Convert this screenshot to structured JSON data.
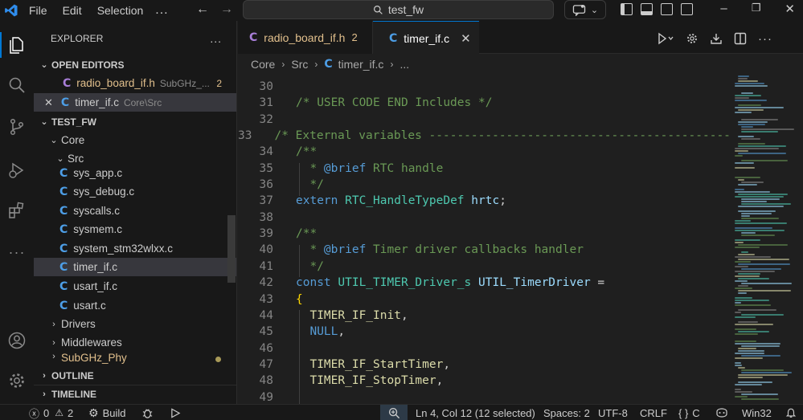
{
  "titlebar": {
    "menu": [
      "File",
      "Edit",
      "Selection"
    ],
    "more": "...",
    "search": "test_fw"
  },
  "sidebar": {
    "title": "EXPLORER",
    "more": "...",
    "open_editors_label": "OPEN EDITORS",
    "open_editors": [
      {
        "name": "radio_board_if.h",
        "desc": "SubGHz_...",
        "badge": "2"
      },
      {
        "name": "timer_if.c",
        "desc": "Core\\Src",
        "close": "✕"
      }
    ],
    "project_label": "TEST_FW",
    "tree": {
      "core": "Core",
      "src": "Src",
      "files": [
        "sys_app.c",
        "sys_debug.c",
        "syscalls.c",
        "sysmem.c",
        "system_stm32wlxx.c",
        "timer_if.c",
        "usart_if.c",
        "usart.c"
      ],
      "drivers": "Drivers",
      "middlewares": "Middlewares",
      "subghz": "SubGHz_Phy"
    },
    "outline_label": "OUTLINE",
    "timeline_label": "TIMELINE"
  },
  "tabs": [
    {
      "name": "radio_board_if.h",
      "badge": "2"
    },
    {
      "name": "timer_if.c",
      "close": "✕"
    }
  ],
  "breadcrumb": {
    "parts": [
      "Core",
      "Src",
      "timer_if.c",
      "..."
    ]
  },
  "code": {
    "lines": [
      {
        "n": "30",
        "text": ""
      },
      {
        "n": "31",
        "text": "/* USER CODE END Includes */"
      },
      {
        "n": "32",
        "text": ""
      },
      {
        "n": "33",
        "text": "/* External variables ---------------------------------------------"
      },
      {
        "n": "34",
        "text": "/**"
      },
      {
        "n": "35",
        "text": "  * @brief RTC handle"
      },
      {
        "n": "36",
        "text": "  */"
      },
      {
        "n": "37",
        "text": "extern RTC_HandleTypeDef hrtc;"
      },
      {
        "n": "38",
        "text": ""
      },
      {
        "n": "39",
        "text": "/**"
      },
      {
        "n": "40",
        "text": "  * @brief Timer driver callbacks handler"
      },
      {
        "n": "41",
        "text": "  */"
      },
      {
        "n": "42",
        "text": "const UTIL_TIMER_Driver_s UTIL_TimerDriver ="
      },
      {
        "n": "43",
        "text": "{"
      },
      {
        "n": "44",
        "text": "  TIMER_IF_Init,"
      },
      {
        "n": "45",
        "text": "  NULL,"
      },
      {
        "n": "46",
        "text": ""
      },
      {
        "n": "47",
        "text": "  TIMER_IF_StartTimer,"
      },
      {
        "n": "48",
        "text": "  TIMER_IF_StopTimer,"
      },
      {
        "n": "49",
        "text": ""
      }
    ],
    "tokens": {
      "c31": "/* USER CODE END Includes */",
      "c33": "/* External variables ---------------------------------------------",
      "c34": "/**",
      "c35a": "  * ",
      "c35b": "@brief",
      "c35c": " RTC handle",
      "c36": "  */",
      "k37": "extern",
      "t37": "RTC_HandleTypeDef",
      "v37": "hrtc",
      "p37": ";",
      "c39": "/**",
      "c40a": "  * ",
      "c40b": "@brief",
      "c40c": " Timer driver callbacks handler",
      "c41": "  */",
      "k42": "const",
      "t42": "UTIL_TIMER_Driver_s",
      "v42": "UTIL_TimerDriver",
      "p42": " =",
      "b43": "{",
      "f44": "TIMER_IF_Init",
      "f45": "NULL",
      "f47": "TIMER_IF_StartTimer",
      "f48": "TIMER_IF_StopTimer",
      "comma": ","
    }
  },
  "status": {
    "errors": "0",
    "warnings": "2",
    "build": "Build",
    "position": "Ln 4, Col 12 (12 selected)",
    "spaces": "Spaces: 2",
    "encoding": "UTF-8",
    "eol": "CRLF",
    "language": "C",
    "platform": "Win32"
  },
  "colors": {
    "accent": "#0078d4",
    "c_icon": "#4d9ee6",
    "modified": "#e2c08d",
    "comment": "#6a9955",
    "keyword": "#569cd6",
    "type": "#4ec9b0",
    "function": "#dcdcaa",
    "variable": "#9cdcfe"
  }
}
